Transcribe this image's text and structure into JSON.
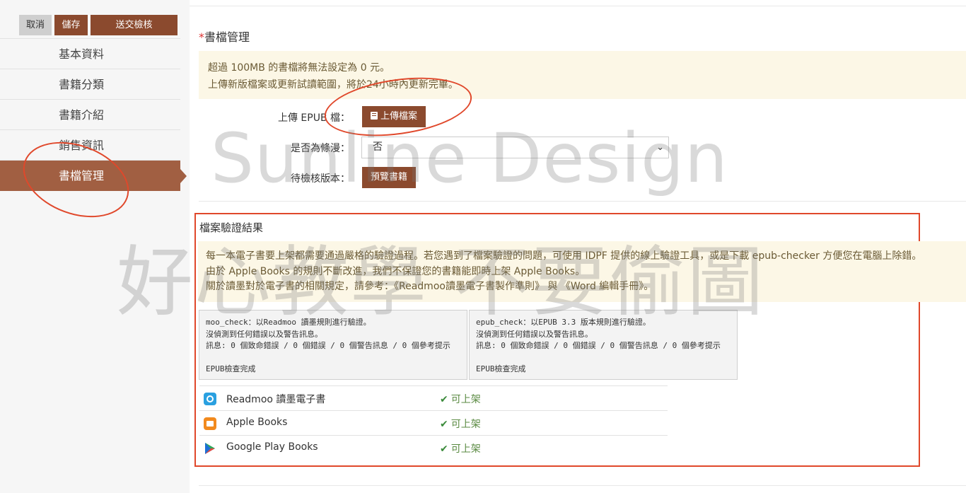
{
  "toolbar": {
    "cancel_label": "取消",
    "save_label": "儲存",
    "submit_label": "送交檢核"
  },
  "sidebar": {
    "items": [
      {
        "label": "基本資料"
      },
      {
        "label": "書籍分類"
      },
      {
        "label": "書籍介紹"
      },
      {
        "label": "銷售資訊"
      },
      {
        "label": "書檔管理",
        "active": true
      }
    ]
  },
  "section": {
    "required_mark": "*",
    "title": "書檔管理",
    "notice_lines": [
      "超過 100MB 的書檔將無法設定為 0 元。",
      "上傳新版檔案或更新試讀範圍，將於24小時內更新完畢。"
    ]
  },
  "form": {
    "upload_label": "上傳 EPUB 檔：",
    "upload_button": "上傳檔案",
    "upload_icon": "book-icon",
    "comic_label": "是否為條漫：",
    "comic_value": "否",
    "pending_label": "待檢核版本：",
    "preview_button": "預覽書籍"
  },
  "result": {
    "title": "檔案驗證結果",
    "notice_lines": [
      "每一本電子書要上架都需要通過嚴格的驗證過程。若您遇到了檔案驗證的問題，可使用 IDPF 提供的線上驗證工具，或是下載 epub-checker 方便您在電腦上除錯。",
      "由於 Apple Books 的規則不斷改進，我們不保證您的書籍能即時上架 Apple Books。",
      "關於讀墨對於電子書的相關規定，請參考：《Readmoo讀墨電子書製作準則》 與 《Word 編輯手冊》。"
    ],
    "checks": [
      {
        "line1": "moo_check：以Readmoo 讀墨規則進行驗證。",
        "line2": "沒偵測到任何錯誤以及警告訊息。",
        "line3": "訊息: 0 個致命錯誤 / 0 個錯誤 / 0 個警告訊息 / 0 個參考提示",
        "line4": "EPUB檢查完成"
      },
      {
        "line1": "epub_check：以EPUB 3.3 版本規則進行驗證。",
        "line2": "沒偵測到任何錯誤以及警告訊息。",
        "line3": "訊息: 0 個致命錯誤 / 0 個錯誤 / 0 個警告訊息 / 0 個參考提示",
        "line4": "EPUB檢查完成"
      }
    ],
    "stores": [
      {
        "name": "Readmoo 讀墨電子書",
        "status": "可上架",
        "icon": "readmoo-icon"
      },
      {
        "name": "Apple Books",
        "status": "可上架",
        "icon": "apple-books-icon"
      },
      {
        "name": "Google Play Books",
        "status": "可上架",
        "icon": "google-play-books-icon"
      }
    ]
  },
  "watermark": {
    "line1": "Sunline Design",
    "line2": "好心教學 不要偷圖"
  },
  "colors": {
    "brand": "#8b4a2e",
    "active_nav": "#a15f42",
    "notice_bg": "#fcf7e6",
    "highlight": "#e0482b",
    "ok": "#3a8a3a"
  }
}
